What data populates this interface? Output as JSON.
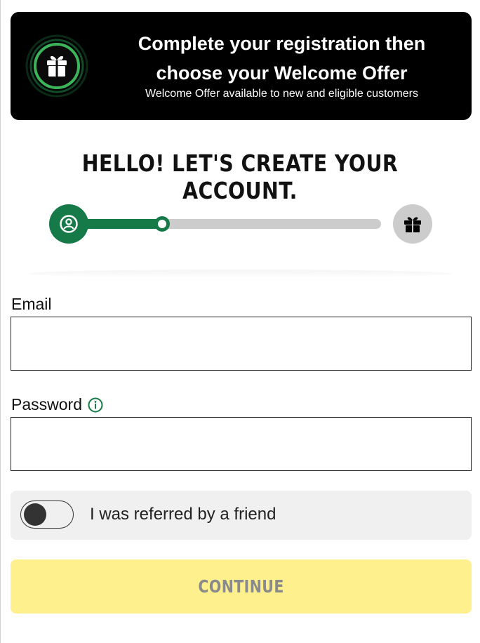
{
  "banner": {
    "title_line1": "Complete your registration then",
    "title_line2": "choose your Welcome Offer",
    "subtitle": "Welcome Offer available to new and eligible customers",
    "icon": "gift-icon"
  },
  "heading": "HELLO! LET'S CREATE YOUR ACCOUNT.",
  "progress": {
    "steps": [
      {
        "icon": "user-icon",
        "state": "active"
      },
      {
        "icon": "gift-icon",
        "state": "inactive"
      }
    ],
    "fraction_complete": 0.3
  },
  "form": {
    "email_label": "Email",
    "email_value": "",
    "password_label": "Password",
    "password_value": "",
    "password_info_icon": "info-icon"
  },
  "referral": {
    "label": "I was referred by a friend",
    "toggle_on": false
  },
  "continue_label": "CONTINUE",
  "colors": {
    "brand_green": "#157a48",
    "banner_bg": "#000000",
    "continue_bg": "#fdf08d",
    "continue_text": "#8a8a8a",
    "track_inactive": "#cccccc"
  }
}
